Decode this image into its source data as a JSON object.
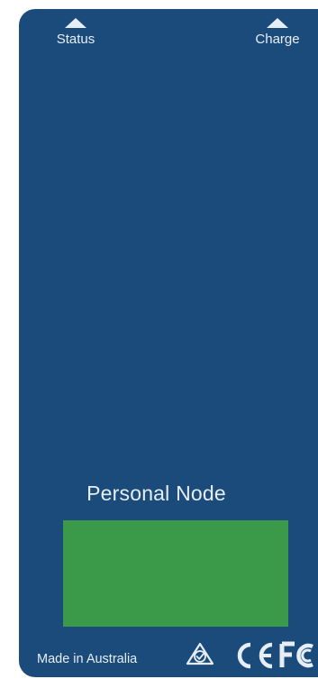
{
  "indicators": {
    "status_label": "Status",
    "charge_label": "Charge"
  },
  "product": {
    "name": "Personal Node"
  },
  "footer": {
    "origin_text": "Made in Australia",
    "cert_marks": [
      "rcm-icon",
      "ce-mark-icon",
      "fcc-mark-icon"
    ]
  },
  "colors": {
    "panel": "#1b4b7b",
    "text": "#e6edf5",
    "green_pad": "#3a9a4a"
  }
}
